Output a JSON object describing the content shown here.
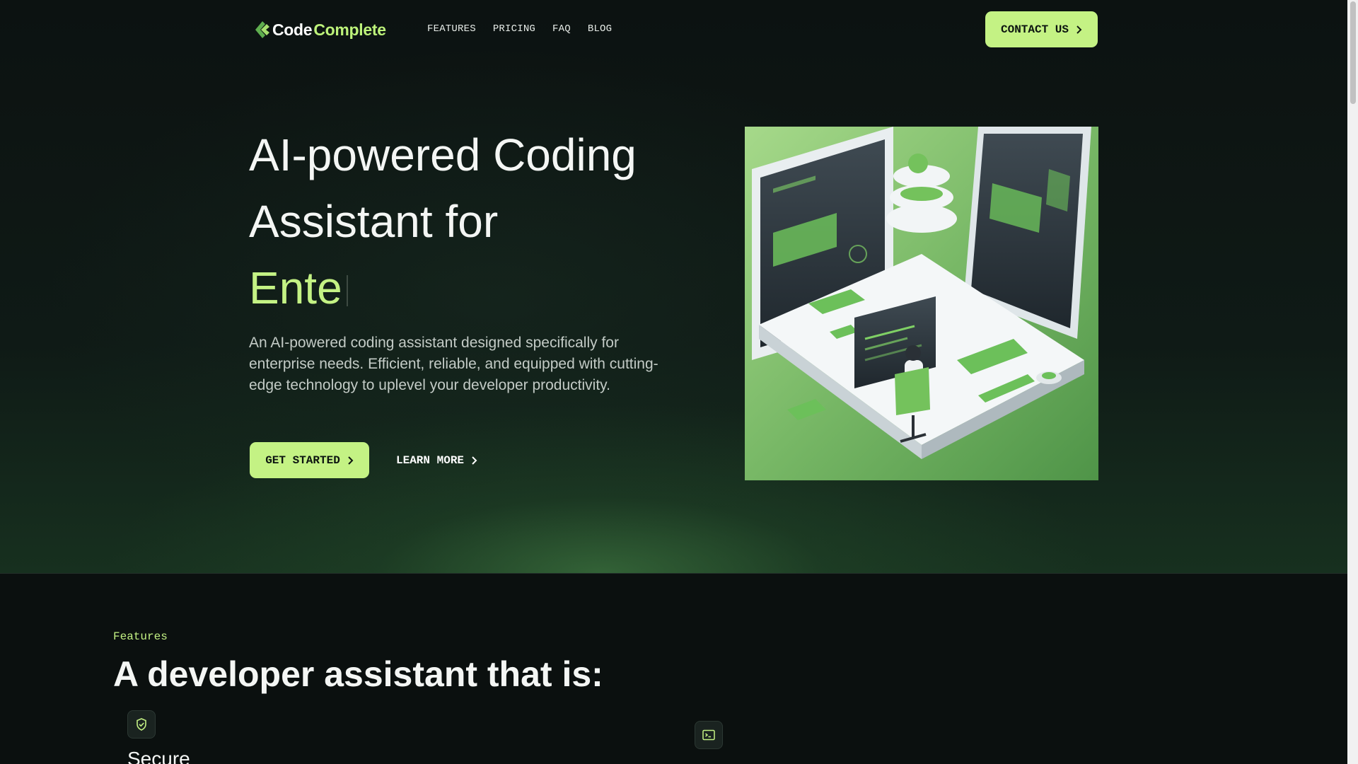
{
  "brand": {
    "name_part1": "Code",
    "name_part2": "Complete"
  },
  "nav": {
    "links": [
      "FEATURES",
      "PRICING",
      "FAQ",
      "BLOG"
    ],
    "contact_label": "CONTACT US"
  },
  "hero": {
    "title_line1": "AI-powered Coding",
    "title_line2": "Assistant for",
    "title_typed": "Ente",
    "description": "An AI-powered coding assistant designed specifically for enterprise needs. Efficient, reliable, and equipped with cutting-edge technology to uplevel your developer productivity.",
    "primary_cta": "GET STARTED",
    "secondary_cta": "LEARN MORE"
  },
  "features": {
    "eyebrow": "Features",
    "title": "A developer assistant that is:",
    "items": [
      {
        "label": "Secure",
        "icon": "shield-check-icon"
      },
      {
        "label": "",
        "icon": "terminal-icon"
      }
    ]
  },
  "colors": {
    "accent": "#c4f284",
    "background": "#0b1110",
    "illustration_green": "#6fb15d"
  }
}
